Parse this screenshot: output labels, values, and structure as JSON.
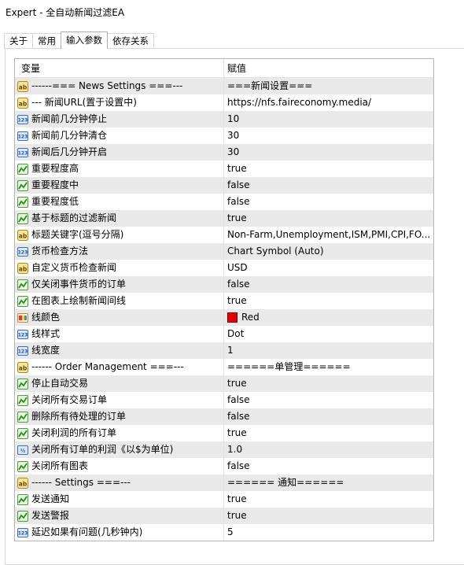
{
  "window": {
    "title": "Expert - 全自动新闻过滤EA"
  },
  "tabs": [
    {
      "label": "关于"
    },
    {
      "label": "常用"
    },
    {
      "label": "输入参数",
      "active": true
    },
    {
      "label": "依存关系"
    }
  ],
  "table": {
    "col_variable": "变量",
    "col_value": "赋值",
    "rows": [
      {
        "icon": "ab-string-icon",
        "name": "------=== News Settings ===---",
        "value": "===新闻设置==="
      },
      {
        "icon": "ab-string-icon",
        "name": "--- 新闻URL(置于设置中)",
        "value": "https://nfs.faireconomy.media/"
      },
      {
        "icon": "integer-123-icon",
        "name": "新闻前几分钟停止",
        "value": "10"
      },
      {
        "icon": "integer-123-icon",
        "name": "新闻前几分钟清仓",
        "value": "30"
      },
      {
        "icon": "integer-123-icon",
        "name": "新闻后几分钟开启",
        "value": "30"
      },
      {
        "icon": "boolean-chart-icon",
        "name": "重要程度高",
        "value": "true"
      },
      {
        "icon": "boolean-chart-icon",
        "name": "重要程度中",
        "value": "false"
      },
      {
        "icon": "boolean-chart-icon",
        "name": "重要程度低",
        "value": "false"
      },
      {
        "icon": "boolean-chart-icon",
        "name": "基于标题的过滤新闻",
        "value": "true"
      },
      {
        "icon": "ab-string-icon",
        "name": "标题关键字(逗号分隔)",
        "value": "Non-Farm,Unemployment,ISM,PMI,CPI,FO..."
      },
      {
        "icon": "integer-123-icon",
        "name": "货币检查方法",
        "value": "Chart Symbol (Auto)"
      },
      {
        "icon": "ab-string-icon",
        "name": "自定义货币检查新闻",
        "value": "USD"
      },
      {
        "icon": "boolean-chart-icon",
        "name": "仅关闭事件货币的订单",
        "value": "false"
      },
      {
        "icon": "boolean-chart-icon",
        "name": "在图表上绘制新闻间线",
        "value": "true"
      },
      {
        "icon": "color-palette-icon",
        "name": "线颜色",
        "value": "Red",
        "swatch": "#e60000"
      },
      {
        "icon": "integer-123-icon",
        "name": "线样式",
        "value": "Dot"
      },
      {
        "icon": "integer-123-icon",
        "name": "线宽度",
        "value": "1"
      },
      {
        "icon": "ab-string-icon",
        "name": "------ Order Management ===---",
        "value": "======单管理======"
      },
      {
        "icon": "boolean-chart-icon",
        "name": "停止自动交易",
        "value": "true"
      },
      {
        "icon": "boolean-chart-icon",
        "name": "关闭所有交易订单",
        "value": "false"
      },
      {
        "icon": "boolean-chart-icon",
        "name": "删除所有待处理的订单",
        "value": "false"
      },
      {
        "icon": "boolean-chart-icon",
        "name": "关闭利润的所有订单",
        "value": "true"
      },
      {
        "icon": "double-fraction-icon",
        "name": "关闭所有订单的利润《以$为单位)",
        "value": "1.0"
      },
      {
        "icon": "boolean-chart-icon",
        "name": "关闭所有图表",
        "value": "false"
      },
      {
        "icon": "ab-string-icon",
        "name": "------ Settings ===---",
        "value": "====== 通知======"
      },
      {
        "icon": "boolean-chart-icon",
        "name": "发送通知",
        "value": "true"
      },
      {
        "icon": "boolean-chart-icon",
        "name": "发送警报",
        "value": "true"
      },
      {
        "icon": "integer-123-icon",
        "name": "延迟如果有问题(几秒钟内)",
        "value": "5"
      }
    ]
  }
}
